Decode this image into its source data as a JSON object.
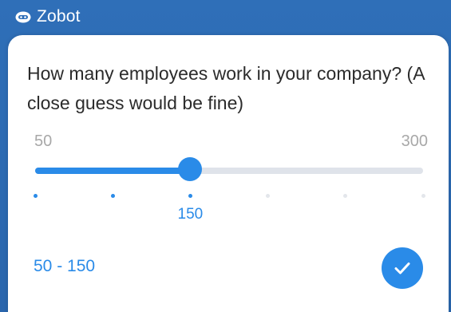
{
  "header": {
    "bot_name": "Zobot",
    "icon": "bot-icon"
  },
  "question": {
    "text": "How many employees work in your company? (A close guess would be fine)"
  },
  "slider": {
    "min_label": "50",
    "max_label": "300",
    "min": 50,
    "max": 300,
    "value": 150,
    "value_label": "150",
    "steps": [
      50,
      100,
      150,
      200,
      250,
      300
    ],
    "accent_color": "#2a8be8",
    "track_color": "#dfe3ea"
  },
  "selection": {
    "text": "50 - 150"
  },
  "submit": {
    "icon": "checkmark-icon"
  },
  "colors": {
    "header_bg": "#2f6fb8",
    "accent": "#2a8be8"
  }
}
